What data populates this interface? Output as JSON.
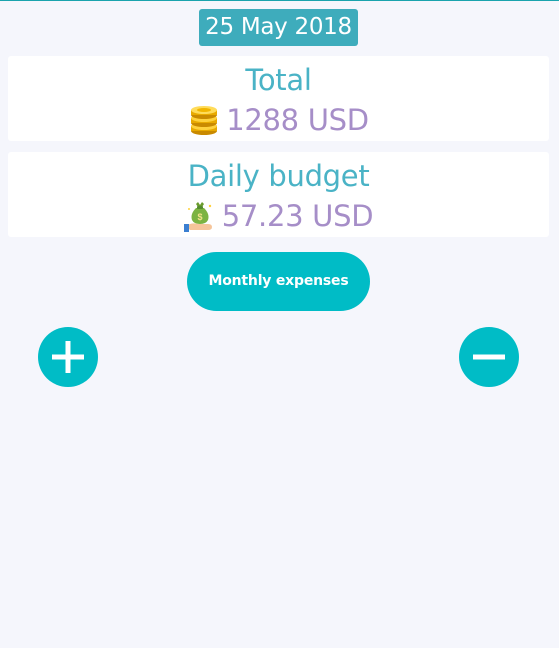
{
  "header": {
    "date": "25 May 2018"
  },
  "total_card": {
    "title": "Total",
    "value": "1288 USD",
    "icon": "coins-icon"
  },
  "daily_card": {
    "title": "Daily budget",
    "value": "57.23 USD",
    "icon": "money-bag-hand-icon"
  },
  "actions": {
    "monthly_label": "Monthly expenses",
    "add_icon": "plus-icon",
    "subtract_icon": "minus-icon"
  },
  "colors": {
    "accent": "#00bcc6",
    "date_badge": "#3eacbc",
    "title_text": "#4ab3c6",
    "value_text": "#a68ec8",
    "background": "#f5f6fc"
  }
}
